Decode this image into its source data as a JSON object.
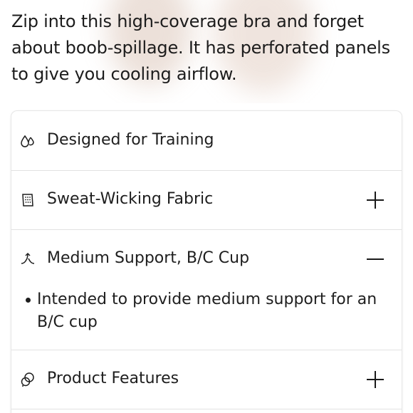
{
  "description": {
    "text": "Zip into this high-coverage bra and forget about boob-spillage. It has perforated panels to give you cooling airflow."
  },
  "accordion": {
    "items": [
      {
        "label": "Designed for Training",
        "icon": "droplets-icon",
        "toggle": "none",
        "expanded": false
      },
      {
        "label": "Sweat-Wicking Fabric",
        "icon": "fabric-swatch-icon",
        "toggle": "plus",
        "expanded": false
      },
      {
        "label": "Medium Support, B/C Cup",
        "icon": "support-lift-icon",
        "toggle": "minus",
        "expanded": true,
        "details": [
          "Intended to provide medium support for an B/C cup"
        ]
      },
      {
        "label": "Product Features",
        "icon": "features-icon",
        "toggle": "plus",
        "expanded": false
      }
    ]
  },
  "colors": {
    "text": "#1e1e1e",
    "divider": "#e2e2e2",
    "background": "#ffffff"
  }
}
